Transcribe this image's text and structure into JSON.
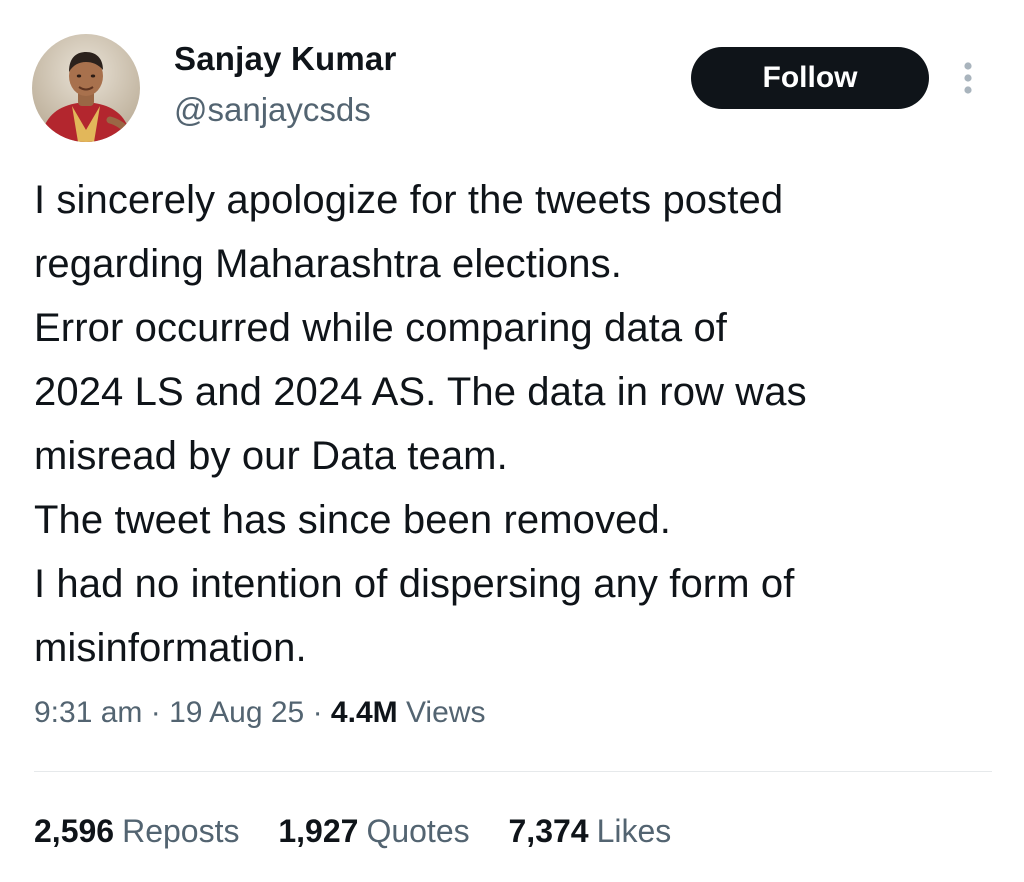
{
  "author": {
    "name": "Sanjay Kumar",
    "handle": "@sanjaycsds",
    "avatar_icon": "profile-photo"
  },
  "follow_label": "Follow",
  "more_icon": "more-vertical-icon",
  "tweet": {
    "lines": [
      "I sincerely apologize for the tweets posted",
      "regarding Maharashtra elections.",
      "Error occurred while comparing data of",
      "2024 LS and 2024 AS. The data in row was",
      "misread by our Data team.",
      "The tweet has since been removed.",
      "I had no intention of dispersing any form of",
      "misinformation."
    ]
  },
  "meta": {
    "time": "9:31 am",
    "sep": "·",
    "date": "19 Aug 25",
    "views_count": "4.4M",
    "views_label": "Views"
  },
  "stats": {
    "reposts": {
      "count": "2,596",
      "label": "Reposts"
    },
    "quotes": {
      "count": "1,927",
      "label": "Quotes"
    },
    "likes": {
      "count": "7,374",
      "label": "Likes"
    }
  },
  "colors": {
    "text_primary": "#0f1419",
    "text_secondary": "#536471",
    "button_bg": "#0f1419",
    "divider": "#e6e9eb"
  }
}
